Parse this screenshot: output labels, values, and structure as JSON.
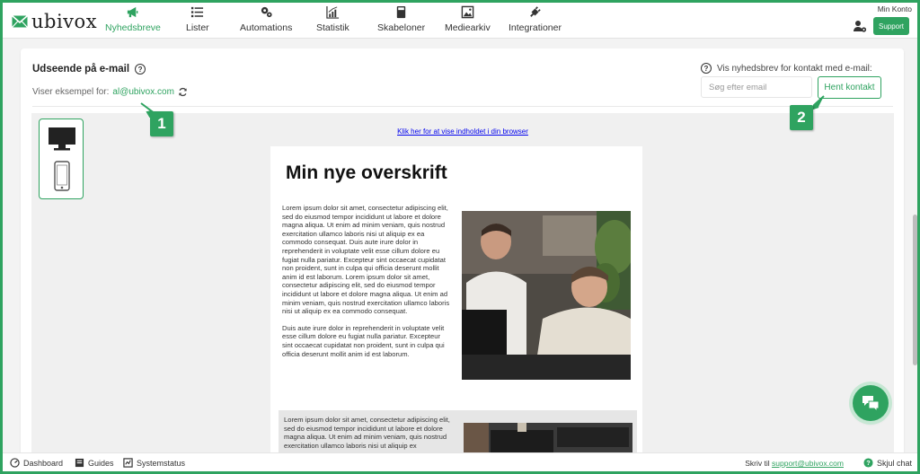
{
  "colors": {
    "accent": "#2fa360",
    "link": "#0000ee"
  },
  "nav": {
    "logo": "ubivox",
    "items": [
      {
        "label": "Nyhedsbreve",
        "icon": "megaphone-icon",
        "active": true
      },
      {
        "label": "Lister",
        "icon": "list-icon"
      },
      {
        "label": "Automations",
        "icon": "gears-icon"
      },
      {
        "label": "Statistik",
        "icon": "chart-icon"
      },
      {
        "label": "Skabeloner",
        "icon": "template-icon"
      },
      {
        "label": "Mediearkiv",
        "icon": "image-icon"
      },
      {
        "label": "Integrationer",
        "icon": "plug-icon"
      }
    ],
    "account": "Min Konto",
    "support": "Support"
  },
  "page": {
    "title": "Udseende på e-mail",
    "example_prefix": "Viser eksempel for:",
    "example_email": "al@ubivox.com",
    "contact_label": "Vis nyhedsbrev for kontakt med e-mail:",
    "search_placeholder": "Søg efter email",
    "fetch_button": "Hent kontakt"
  },
  "preview": {
    "browser_link": "Klik her for at vise indholdet i din browser",
    "heading": "Min nye overskrift",
    "para1": "Lorem ipsum dolor sit amet, consectetur adipiscing elit, sed do eiusmod tempor incididunt ut labore et dolore magna aliqua. Ut enim ad minim veniam, quis nostrud exercitation ullamco laboris nisi ut aliquip ex ea commodo consequat. Duis aute irure dolor in reprehenderit in voluptate velit esse cillum dolore eu fugiat nulla pariatur. Excepteur sint occaecat cupidatat non proident, sunt in culpa qui officia deserunt mollit anim id est laborum. Lorem ipsum dolor sit amet, consectetur adipiscing elit, sed do eiusmod tempor incididunt ut labore et dolore magna aliqua. Ut enim ad minim veniam, quis nostrud exercitation ullamco laboris nisi ut aliquip ex ea commodo consequat.",
    "para2": "Duis aute irure dolor in reprehenderit in voluptate velit esse cillum dolore eu fugiat nulla pariatur. Excepteur sint occaecat cupidatat non proident, sunt in culpa qui officia deserunt mollit anim id est laborum.",
    "para3": "Lorem ipsum dolor sit amet, consectetur adipiscing elit, sed do eiusmod tempor incididunt ut labore et dolore magna aliqua. Ut enim ad minim veniam, quis nostrud exercitation ullamco laboris nisi ut aliquip ex"
  },
  "callouts": {
    "one": "1",
    "two": "2"
  },
  "bottom": {
    "dashboard": "Dashboard",
    "guides": "Guides",
    "status": "Systemstatus",
    "write_prefix": "Skriv til",
    "support_email": "support@ubivox.com",
    "hide_chat": "Skjul chat"
  }
}
